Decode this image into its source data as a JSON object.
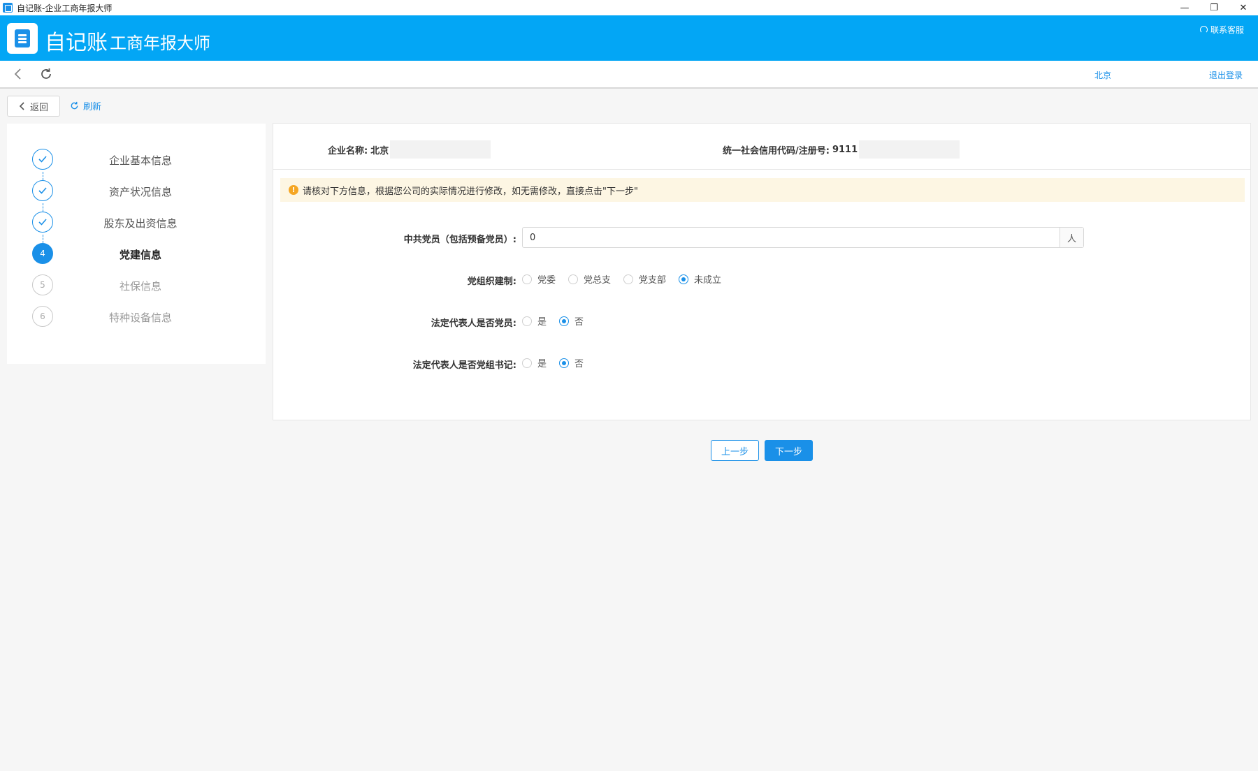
{
  "window": {
    "title": "自记账-企业工商年报大师",
    "minimize": "—",
    "restore": "❐",
    "close": "✕"
  },
  "header": {
    "brand": "自记账",
    "subtitle": "工商年报大师",
    "support": "联系客服"
  },
  "nav": {
    "company": "北京",
    "logout": "退出登录"
  },
  "toolbar": {
    "return_label": "返回",
    "refresh_label": "刷新"
  },
  "steps": [
    {
      "label": "企业基本信息",
      "status": "done"
    },
    {
      "label": "资产状况信息",
      "status": "done"
    },
    {
      "label": "股东及出资信息",
      "status": "done"
    },
    {
      "label": "党建信息",
      "status": "active",
      "number": "4"
    },
    {
      "label": "社保信息",
      "status": "pending",
      "number": "5"
    },
    {
      "label": "特种设备信息",
      "status": "pending",
      "number": "6"
    }
  ],
  "info": {
    "company_label": "企业名称:",
    "company_value": "北京",
    "credit_label": "统一社会信用代码/注册号:",
    "credit_value": "9111"
  },
  "notice": "请核对下方信息，根据您公司的实际情况进行修改，如无需修改，直接点击\"下一步\"",
  "form": {
    "members_label": "中共党员（包括预备党员）:",
    "members_value": "0",
    "members_unit": "人",
    "org_label": "党组织建制:",
    "org_options": [
      "党委",
      "党总支",
      "党支部",
      "未成立"
    ],
    "org_selected": "未成立",
    "legal_member_label": "法定代表人是否党员:",
    "legal_secretary_label": "法定代表人是否党组书记:",
    "yes": "是",
    "no": "否",
    "legal_member_selected": "否",
    "legal_secretary_selected": "否"
  },
  "buttons": {
    "prev": "上一步",
    "next": "下一步"
  },
  "colors": {
    "accent": "#1a90e8",
    "header": "#03a6f5",
    "notice_bg": "#fdf6e3",
    "warning": "#f5a623"
  }
}
